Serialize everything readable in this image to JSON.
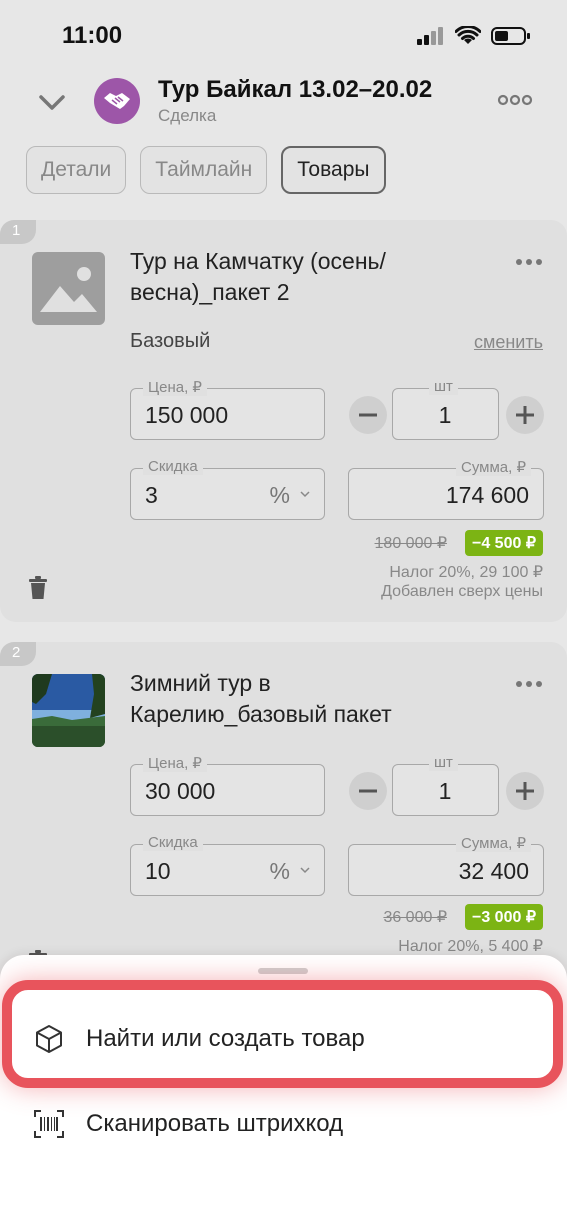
{
  "status_bar": {
    "time": "11:00"
  },
  "header": {
    "title": "Тур Байкал 13.02–20.02",
    "subtitle": "Сделка",
    "avatar_color": "#9d56a8"
  },
  "tabs": [
    {
      "label": "Детали",
      "active": false
    },
    {
      "label": "Таймлайн",
      "active": false
    },
    {
      "label": "Товары",
      "active": true
    }
  ],
  "products": [
    {
      "index": "1",
      "name": "Тур на Камчатку (осень/весна)_пакет 2",
      "variant": "Базовый",
      "change_label": "сменить",
      "price_label": "Цена, ₽",
      "price": "150 000",
      "qty_label": "шт",
      "qty": "1",
      "discount_label": "Скидка",
      "discount": "3",
      "discount_unit": "%",
      "sum_label": "Сумма, ₽",
      "sum": "174 600",
      "old_price": "180 000 ₽",
      "discount_amount": "−4 500 ₽",
      "tax": "Налог 20%, 29 100 ₽",
      "added_note": "Добавлен сверх цены"
    },
    {
      "index": "2",
      "name": "Зимний тур в Карелию_базовый пакет",
      "price_label": "Цена, ₽",
      "price": "30 000",
      "qty_label": "шт",
      "qty": "1",
      "discount_label": "Скидка",
      "discount": "10",
      "discount_unit": "%",
      "sum_label": "Сумма, ₽",
      "sum": "32 400",
      "old_price": "36 000 ₽",
      "discount_amount": "−3 000 ₽",
      "tax": "Налог 20%, 5 400 ₽"
    }
  ],
  "sheet": {
    "items": [
      {
        "label": "Найти или создать товар",
        "icon": "cube-icon",
        "highlighted": true
      },
      {
        "label": "Сканировать штрихкод",
        "icon": "barcode-icon",
        "highlighted": false
      }
    ]
  },
  "colors": {
    "highlight": "#e8545c",
    "discount_green": "#7cb414"
  }
}
